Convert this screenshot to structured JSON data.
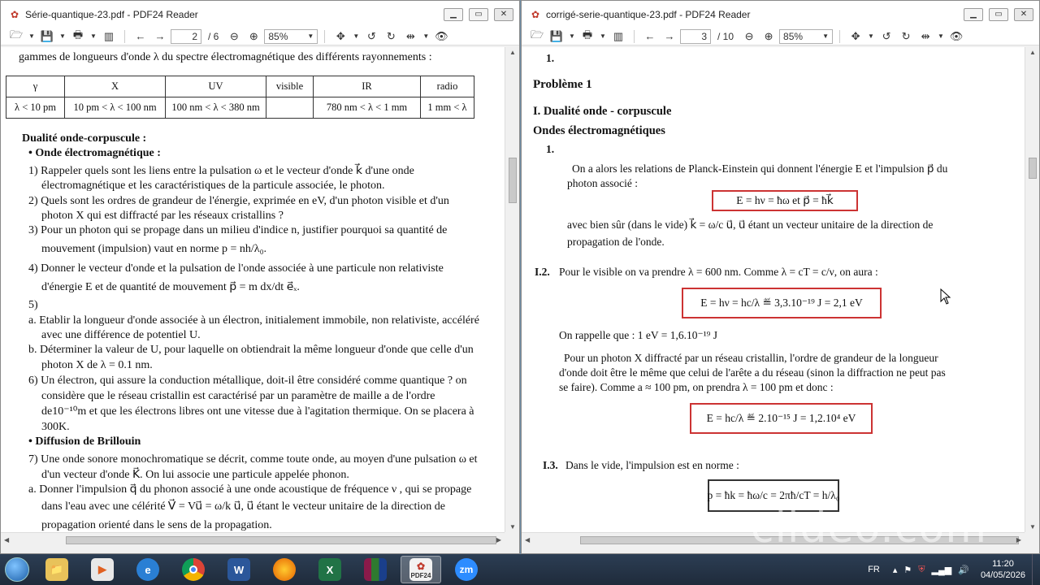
{
  "windows": [
    {
      "title": "Série-quantique-23.pdf - PDF24 Reader",
      "page_current": "2",
      "page_total": "/ 6",
      "zoom": "85%"
    },
    {
      "title": "corrigé-serie-quantique-23.pdf - PDF24 Reader",
      "page_current": "3",
      "page_total": "/ 10",
      "zoom": "85%"
    }
  ],
  "left_doc": {
    "intro": "gammes de longueurs d'onde λ du spectre électromagnétique des différents rayonnements :",
    "table": {
      "headers": [
        "γ",
        "X",
        "UV",
        "visible",
        "IR",
        "radio"
      ],
      "row": [
        "λ < 10 pm",
        "10 pm < λ < 100 nm",
        "100 nm < λ < 380 nm",
        "",
        "780 nm < λ < 1 mm",
        "1 mm < λ"
      ]
    },
    "section_title": "Dualité onde-corpuscule :",
    "bullet1": "Onde électromagnétique :",
    "lines": [
      "1) Rappeler quels sont les liens entre la pulsation ω et le vecteur d'onde k⃗ d'une onde",
      "électromagnétique et les caractéristiques de la particule associée, le photon.",
      "2) Quels sont les ordres de grandeur de l'énergie, exprimée en eV, d'un photon visible et d'un",
      "photon X qui est diffracté par les réseaux cristallins ?",
      "3) Pour un photon qui se propage dans un milieu d'indice n, justifier pourquoi sa quantité de",
      "mouvement (impulsion) vaut en norme p = nh/λ₀.",
      "4) Donner le vecteur d'onde et la pulsation de l'onde associée à une particule non relativiste",
      "d'énergie E et de quantité de mouvement p⃗ = m dx/dt e⃗ₓ.",
      "5)",
      "a.  Etablir la longueur d'onde associée à un électron, initialement immobile, non relativiste, accéléré",
      "avec une différence de potentiel U.",
      "b.  Déterminer la valeur de U, pour laquelle on obtiendrait la même longueur d'onde que celle d'un",
      "photon X de λ = 0.1 nm.",
      "6) Un électron, qui assure la conduction métallique, doit-il être considéré comme quantique ? on",
      "considère que le réseau cristallin est caractérisé par un paramètre de maille a de l'ordre",
      "de10⁻¹⁰m et que les électrons libres ont une vitesse due à l'agitation thermique. On se placera à",
      "300K."
    ],
    "bullet2": "Diffusion de Brillouin",
    "lines2": [
      "7) Une onde sonore monochromatique se décrit, comme toute onde, au moyen d'une pulsation ω et",
      "d'un vecteur d'onde K⃗. On lui associe une particule appelée phonon.",
      "a.  Donner l'impulsion  q⃗ du phonon associé à une onde acoustique de fréquence ν , qui se propage",
      "dans l'eau avec une célérité V⃗ = Vu⃗ = ω/k u⃗, u⃗ étant le vecteur unitaire de la direction de",
      "propagation orienté dans le sens de la propagation."
    ]
  },
  "right_doc": {
    "top_num": "1.",
    "problem": "Problème 1",
    "h1": "I. Dualité onde - corpuscule",
    "h2": "Ondes électromagnétiques",
    "num1": "1.",
    "p1a": "On a alors les relations de Planck-Einstein qui donnent l'énergie E et l'impulsion p⃗ du",
    "p1b": "photon associé :",
    "eq1": "E = hν = ħω   et   p⃗ = ħk⃗",
    "p2a": "avec bien sûr (dans le vide) k⃗ = ω/c u⃗, u⃗ étant un vecteur unitaire de la direction de",
    "p2b": "propagation de l'onde.",
    "i2_label": "I.2.",
    "i2_text": "Pour le visible on va prendre λ = 600 nm. Comme λ = cT = c/ν, on aura :",
    "eq2": "E = hν = hc/λ  ≝  3,3.10⁻¹⁹ J = 2,1 eV",
    "recall": "On rappelle que : 1 eV = 1,6.10⁻¹⁹ J",
    "p3a": "Pour un photon X diffracté par un réseau cristallin, l'ordre de grandeur de la longueur",
    "p3b": "d'onde doit être le même que celui de l'arête a du réseau (sinon la diffraction ne peut pas",
    "p3c": "se faire). Comme a ≈ 100 pm, on prendra λ = 100 pm et donc :",
    "eq3": "E = hc/λ  ≝  2.10⁻¹⁵ J = 1,2.10⁴ eV",
    "i3_label": "I.3.",
    "i3_text": "Dans le vide, l'impulsion est en norme :",
    "eq4": "p = ħk = ħω/c = 2πħ/cT = h/λ₀"
  },
  "taskbar": {
    "apps": [
      "file-explorer",
      "media-player",
      "internet-explorer",
      "chrome",
      "word",
      "firefox",
      "excel",
      "winrar",
      "pdf24",
      "zoom"
    ],
    "pdf24_label": "PDF24",
    "word_label": "W",
    "excel_label": "X",
    "zoom_label": "zm",
    "lang": "FR",
    "time": "11:20",
    "date": "04/05/2026"
  },
  "watermark": "clideo.com"
}
